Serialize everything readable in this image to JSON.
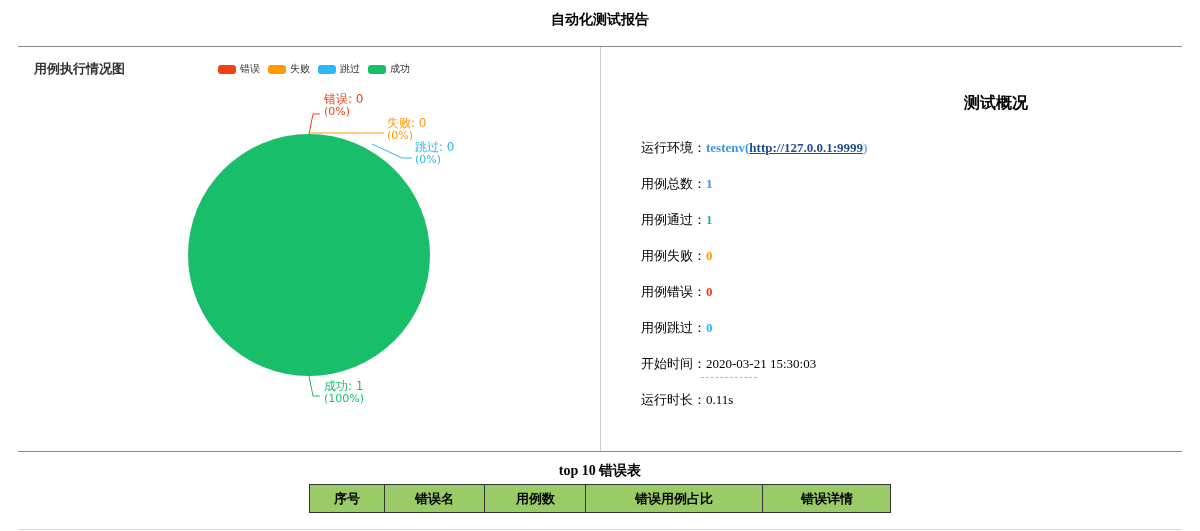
{
  "title": "自动化测试报告",
  "chart_panel": {
    "title": "用例执行情况图",
    "legend": [
      {
        "label": "错误",
        "color": "#ee4115"
      },
      {
        "label": "失败",
        "color": "#ff9a05"
      },
      {
        "label": "跳过",
        "color": "#2db7f5"
      },
      {
        "label": "成功",
        "color": "#19be6b"
      }
    ],
    "chart_data": {
      "type": "pie",
      "values": [
        0,
        0,
        0,
        1
      ]
    },
    "slice_labels": [
      {
        "text": "错误: 0",
        "percent": "(0%)"
      },
      {
        "text": "失败: 0",
        "percent": "(0%)"
      },
      {
        "text": "跳过: 0",
        "percent": "(0%)"
      },
      {
        "text": "成功: 1",
        "percent": "(100%)"
      }
    ]
  },
  "summary": {
    "title": "测试概况",
    "rows": [
      {
        "kind": "env",
        "label": "运行环境：",
        "prefix": "testenv(",
        "link": "http://127.0.0.1:9999",
        "suffix": ")",
        "color": "#3a95e8"
      },
      {
        "kind": "count",
        "label": "用例总数：",
        "value": "1",
        "color": "#3a95e8"
      },
      {
        "kind": "count",
        "label": "用例通过：",
        "value": "1",
        "color": "#19be6b"
      },
      {
        "kind": "count",
        "label": "用例失败：",
        "value": "0",
        "color": "#ff9a05"
      },
      {
        "kind": "count",
        "label": "用例错误：",
        "value": "0",
        "color": "#ee4115"
      },
      {
        "kind": "count",
        "label": "用例跳过：",
        "value": "0",
        "color": "#2db7f5"
      },
      {
        "kind": "time",
        "label": "开始时间：",
        "value": "2020-03-21 15:30:03"
      },
      {
        "kind": "plain",
        "label": "运行时长：",
        "value": "0.11s"
      }
    ]
  },
  "error_table": {
    "title": "top 10 错误表",
    "columns": [
      "序号",
      "错误名",
      "用例数",
      "错误用例占比",
      "错误详情"
    ]
  }
}
